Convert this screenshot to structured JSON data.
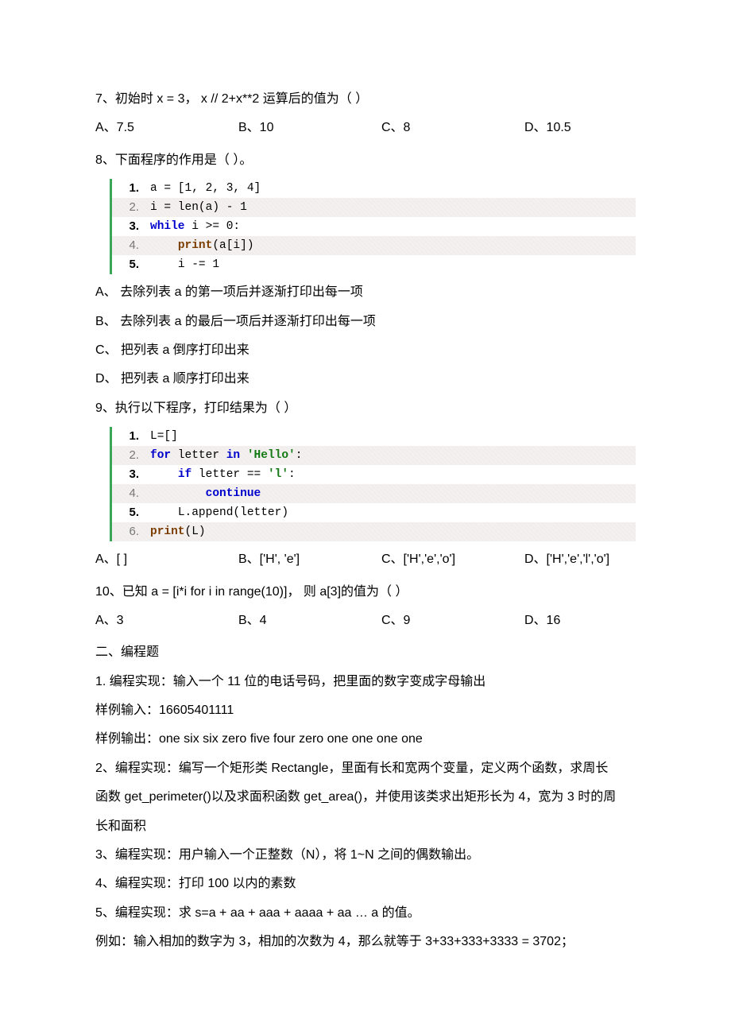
{
  "q7": {
    "text": "7、初始时 x = 3， x // 2+x**2 运算后的值为（   ）",
    "opts": {
      "a": "A、7.5",
      "b": "B、10",
      "c": "C、8",
      "d": "D、10.5"
    }
  },
  "q8": {
    "text": "8、下面程序的作用是（   ）。",
    "code": {
      "l1": "a = [1, 2, 3, 4]",
      "l2": "i = len(a) - 1",
      "l3_kw": "while",
      "l3_rest": " i >= 0:",
      "l4_fn": "print",
      "l4_rest": "(a[i])",
      "l5": "i -= 1"
    },
    "opt_a": "A、 去除列表 a 的第一项后并逐渐打印出每一项",
    "opt_b": "B、 去除列表 a 的最后一项后并逐渐打印出每一项",
    "opt_c": "C、 把列表 a 倒序打印出来",
    "opt_d": "D、 把列表 a 顺序打印出来"
  },
  "q9": {
    "text": "9、执行以下程序，打印结果为（   ）",
    "code": {
      "l1": "L=[]",
      "l2_for": "for",
      "l2_mid": " letter ",
      "l2_in": "in",
      "l2_sp": " ",
      "l2_str": "'Hello'",
      "l2_colon": ":",
      "l3_if": "if",
      "l3_mid": " letter == ",
      "l3_str": "'l'",
      "l3_colon": ":",
      "l4_kw": "continue",
      "l5": "L.append(letter)",
      "l6_fn": "print",
      "l6_rest": "(L)"
    },
    "opts": {
      "a": "A、[ ]",
      "b": "B、['H', 'e']",
      "c": "C、['H','e','o']",
      "d": "D、['H','e','l','o']"
    }
  },
  "q10": {
    "text": "10、已知 a = [i*i for i in range(10)]， 则 a[3]的值为（ ）",
    "opts": {
      "a": "A、3",
      "b": "B、4",
      "c": "C、9",
      "d": "D、16"
    }
  },
  "section2": "二、编程题",
  "p1": {
    "text": "1. 编程实现：输入一个 11 位的电话号码，把里面的数字变成字母输出",
    "sample_in": "样例输入：16605401111",
    "sample_out": "样例输出：one six six zero five four zero one one one one"
  },
  "p2": {
    "line1": "2、编程实现：编写一个矩形类 Rectangle，里面有长和宽两个变量，定义两个函数，求周长",
    "line2": "函数 get_perimeter()以及求面积函数 get_area()，并使用该类求出矩形长为 4，宽为 3 时的周",
    "line3": "长和面积"
  },
  "p3": "3、编程实现：用户输入一个正整数（N），将 1~N 之间的偶数输出。",
  "p4": "4、编程实现：打印 100 以内的素数",
  "p5": "5、编程实现：求 s=a + aa + aaa + aaaa + aa … a 的值。",
  "p5_ex": "例如：输入相加的数字为 3，相加的次数为 4，那么就等于 3+33+333+3333 = 3702；"
}
